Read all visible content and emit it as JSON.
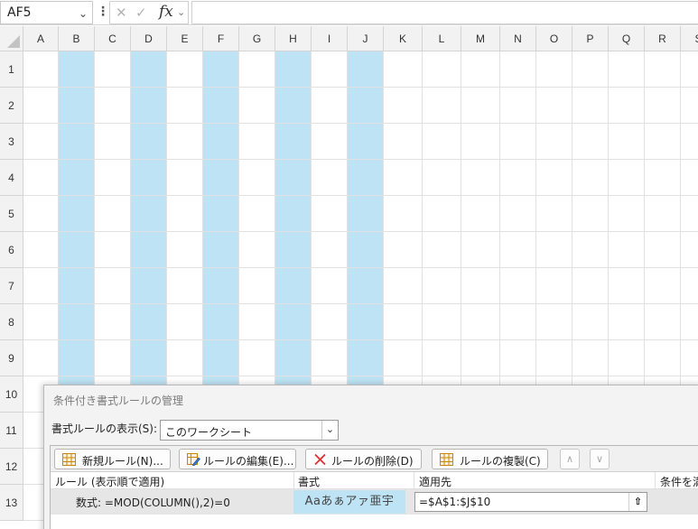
{
  "formula_bar": {
    "name_box": "AF5",
    "name_box_arrow": "⌄",
    "more_icon": "⋮",
    "cancel_icon": "✕",
    "enter_icon": "✓",
    "fx_label": "fx",
    "fx_arrow": "⌄",
    "formula": ""
  },
  "columns": [
    "A",
    "B",
    "C",
    "D",
    "E",
    "F",
    "G",
    "H",
    "I",
    "J",
    "K",
    "L",
    "M",
    "N",
    "O",
    "P",
    "Q",
    "R",
    "S"
  ],
  "rows": [
    "1",
    "2",
    "3",
    "4",
    "5",
    "6",
    "7",
    "8",
    "9",
    "10",
    "11",
    "12",
    "13"
  ],
  "highlighted_columns": [
    "B",
    "D",
    "F",
    "H",
    "J"
  ],
  "highlight_color": "#bde3f4",
  "dialog": {
    "title": "条件付き書式ルールの管理",
    "show_rules_label": "書式ルールの表示(S):",
    "show_rules_value": "このワークシート",
    "buttons": {
      "new_rule": "新規ルール(N)...",
      "edit_rule": "ルールの編集(E)...",
      "delete_rule": "ルールの削除(D)",
      "duplicate_rule": "ルールの複製(C)",
      "move_up": "∧",
      "move_down": "∨"
    },
    "table_headers": {
      "rule": "ルール (表示順で適用)",
      "format": "書式",
      "applies_to": "適用先",
      "stop_if_true": "条件を満"
    },
    "rule_row": {
      "description": "数式: =MOD(COLUMN(),2)=0",
      "format_preview": "Aaあぁアァ亜宇",
      "applies_to": "=$A$1:$J$10",
      "collapse_icon": "⇧"
    }
  }
}
